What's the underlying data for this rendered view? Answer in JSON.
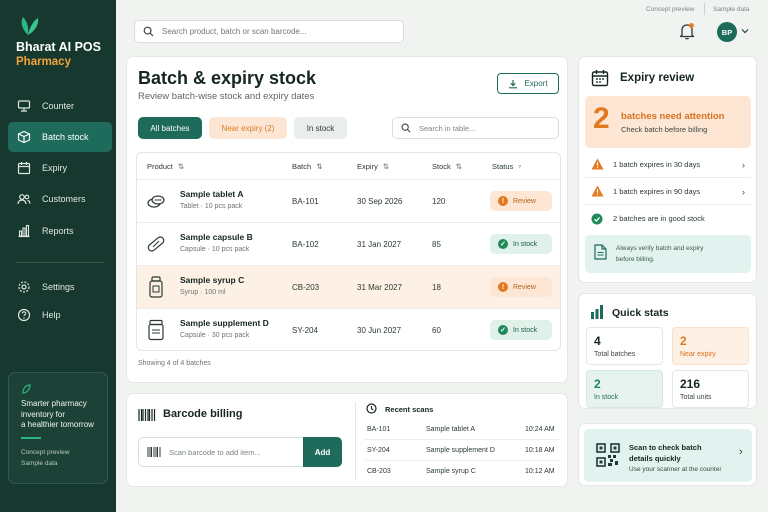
{
  "brand": {
    "name": "Bharat AI POS",
    "sub": "Pharmacy"
  },
  "sidebar": {
    "items": [
      {
        "label": "Counter",
        "icon": "monitor-icon"
      },
      {
        "label": "Batch stock",
        "icon": "box-icon",
        "active": true
      },
      {
        "label": "Expiry",
        "icon": "calendar-icon"
      },
      {
        "label": "Customers",
        "icon": "users-icon"
      },
      {
        "label": "Reports",
        "icon": "chart-icon"
      },
      {
        "label": "Settings",
        "icon": "gear-icon"
      },
      {
        "label": "Help",
        "icon": "help-icon"
      }
    ],
    "promo": {
      "line1": "Smarter pharmacy",
      "line2": "inventory for",
      "line3": "a healthier tomorrow",
      "foot1": "Concept preview",
      "foot2": "Sample data"
    }
  },
  "topbar": {
    "note1": "Concept preview",
    "note2": "Sample data",
    "search_placeholder": "Search product, batch or scan barcode...",
    "avatar": "BP"
  },
  "main": {
    "title": "Batch & expiry stock",
    "subtitle": "Review batch-wise stock and expiry dates",
    "export": "Export",
    "tabs": {
      "all": "All batches",
      "near": "Near expiry (2)",
      "in": "In stock"
    },
    "table_search": "Search in table...",
    "columns": {
      "product": "Product",
      "batch": "Batch",
      "expiry": "Expiry",
      "stock": "Stock",
      "status": "Status"
    },
    "rows": [
      {
        "name": "Sample tablet A",
        "desc": "Tablet · 10 pcs pack",
        "batch": "BA-101",
        "expiry": "30 Sep 2026",
        "stock": "120",
        "status": "Review"
      },
      {
        "name": "Sample capsule B",
        "desc": "Capsule · 10 pcs pack",
        "batch": "BA-102",
        "expiry": "31 Jan 2027",
        "stock": "85",
        "status": "In stock"
      },
      {
        "name": "Sample syrup C",
        "desc": "Syrup · 100 ml",
        "batch": "CB-203",
        "expiry": "31 Mar 2027",
        "stock": "18",
        "status": "Review"
      },
      {
        "name": "Sample supplement D",
        "desc": "Capsule · 30 pcs pack",
        "batch": "SY-204",
        "expiry": "30 Jun 2027",
        "stock": "60",
        "status": "In stock"
      }
    ],
    "showing": "Showing 4 of 4 batches"
  },
  "barcode": {
    "title": "Barcode billing",
    "placeholder": "Scan barcode to add item...",
    "add": "Add",
    "recent_title": "Recent scans",
    "recent": [
      {
        "batch": "BA-101",
        "name": "Sample tablet A",
        "time": "10:24 AM"
      },
      {
        "batch": "SY-204",
        "name": "Sample supplement D",
        "time": "10:18 AM"
      },
      {
        "batch": "CB-203",
        "name": "Sample syrup C",
        "time": "10:12 AM"
      }
    ]
  },
  "expiry": {
    "title": "Expiry review",
    "count": "2",
    "alert_line1": "batches need attention",
    "alert_line2": "Check batch before billing",
    "items": [
      {
        "text": "1 batch expires in 30 days"
      },
      {
        "text": "1 batch expires in 90 days"
      },
      {
        "text": "2 batches are in good stock"
      }
    ],
    "note_line1": "Always verify batch and expiry",
    "note_line2": "before billing."
  },
  "stats": {
    "title": "Quick stats",
    "items": [
      {
        "value": "4",
        "label": "Total batches"
      },
      {
        "value": "2",
        "label": "Near expiry"
      },
      {
        "value": "2",
        "label": "In stock"
      },
      {
        "value": "216",
        "label": "Total units"
      }
    ]
  },
  "scan": {
    "line1": "Scan to check batch",
    "line2": "details quickly",
    "line3": "Use your scanner at the counter"
  },
  "colors": {
    "primary": "#1e6b5c",
    "sidebar": "#17382f",
    "warning": "#e37a1f",
    "success": "#1f8a5a"
  }
}
